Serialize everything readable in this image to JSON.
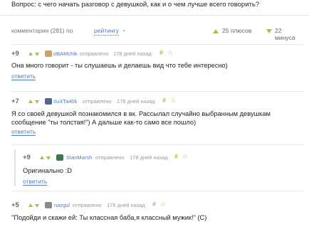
{
  "question": {
    "text": "Вопрос: с чего начать разговор с девушкой, как и о чем лучше всего говорить?"
  },
  "comments_header": {
    "count_label": "комментарии (281) по",
    "sort_label": "рейтингу",
    "plus_label": "25 плюсов",
    "minus_label": "22 минуса"
  },
  "comments": [
    {
      "rating": "+9",
      "author": "oBAMchik",
      "sent_label": "отправлено",
      "time": "178 дней назад",
      "hash": "#",
      "star": "☆",
      "lines": [
        "Она много говорит - ты слушаешь и делаешь вид что тебе интересно)"
      ],
      "reply_label": "ответить"
    },
    {
      "rating": "+7",
      "author": "IIuXTa40k",
      "sent_label": "отправлено",
      "time": "178 дней назад",
      "hash": "#",
      "star": "☆",
      "lines": [
        "Я со своей девушкой познакомился в вк. Рассылал случайно выбранным девушкам",
        "сообщение \"ты толстая!\") А дальше как-то само все пошло)"
      ],
      "reply_label": "ответить"
    },
    {
      "rating": "+9",
      "author": "StanMarsh",
      "sent_label": "отправлено",
      "time": "178 дней назад",
      "hash": "#",
      "star": "☆",
      "lines": [
        "Оригинально :D"
      ],
      "reply_label": "ответить"
    },
    {
      "rating": "+5",
      "author": "nazgul",
      "sent_label": "отправлено",
      "time": "178 дней назад",
      "hash": "#",
      "star": "☆",
      "lines": [
        "\"Подойди и скажи ей: Ты классная баба,я классный мужик!\" (С)"
      ],
      "reply_label": ""
    }
  ],
  "colors": {
    "accent_green": "#9bc449",
    "link_blue": "#4a7ec2",
    "avatar_1": "#c9a46a",
    "avatar_2": "#556688",
    "avatar_3": "#3a7a4a",
    "avatar_4": "#8a8a8a"
  }
}
